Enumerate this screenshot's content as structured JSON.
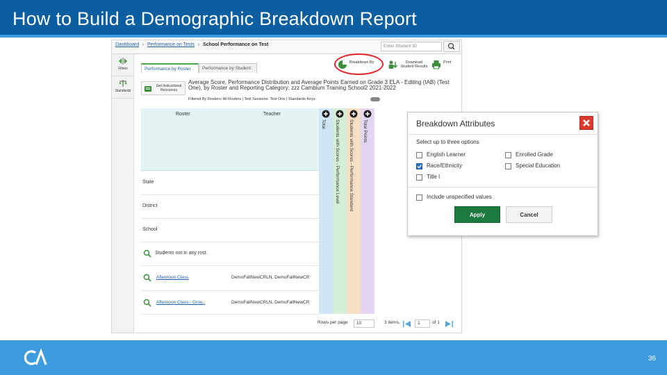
{
  "slide": {
    "title": "How to Build a Demographic Breakdown Report",
    "page_number": "36",
    "colors": {
      "title_bar": "#0b5fa0",
      "footer": "#3d9be0",
      "highlight": "#e0252a",
      "apply": "#1c7a3f"
    }
  },
  "app": {
    "breadcrumb": {
      "dashboard": "Dashboard",
      "performance": "Performance on Tests",
      "current": "School Performance on Test"
    },
    "search": {
      "placeholder": "Enter Student ID"
    },
    "sidebar": [
      {
        "label": "Filters",
        "icon": "filter-icon"
      },
      {
        "label": "Standards",
        "icon": "scale-icon"
      }
    ],
    "tabs": [
      "Performance by Roster",
      "Performance by Student"
    ],
    "toolbar": {
      "breakdown": "Breakdown By",
      "download": "Download Student Results",
      "print": "Print"
    },
    "generate_button": "Get Instructional Resources",
    "report_title": "Average Score, Performance Distribution and Average Points Earned on Grade 3 ELA - Editing (IAB) (Test One), by Roster and Reporting Category: zzz Cambium Training School2 2021-2022",
    "filters_text": "Filtered By Rosters: All Rosters | Test Sessions: Test One | Standards Keys",
    "table": {
      "headers": {
        "roster": "Roster",
        "teacher": "Teacher"
      },
      "rows": [
        {
          "roster": "State",
          "teacher": "",
          "type": "plain"
        },
        {
          "roster": "District",
          "teacher": "",
          "type": "plain"
        },
        {
          "roster": "School",
          "teacher": "",
          "type": "plain"
        },
        {
          "roster": "Students not in any rost.",
          "teacher": "",
          "type": "group"
        },
        {
          "roster": "Afternoon Class",
          "teacher": "DemoFallNewCRLN, DemoFallNewCR",
          "type": "link"
        },
        {
          "roster": "Afternoon Class - Grou..",
          "teacher": "DemoFallNewCRLN, DemoFallNewCR",
          "type": "link"
        }
      ],
      "vertical_columns": [
        {
          "label": "Total",
          "color": "#cfe6f8"
        },
        {
          "label": "Students with Scores - Performance Level",
          "color": "#d5efd6"
        },
        {
          "label": "Students with Scores - Performance Standard",
          "color": "#f7dfc6"
        },
        {
          "label": "Total Points",
          "color": "#e2d6f2"
        }
      ]
    },
    "pager": {
      "rows_label": "Rows per page",
      "rows_value": "10",
      "items_label": "3 items,",
      "page_value": "1",
      "of_label": "of 1"
    }
  },
  "modal": {
    "title": "Breakdown Attributes",
    "subtitle": "Select up to three options",
    "options_left": [
      {
        "label": "English Learner",
        "checked": false
      },
      {
        "label": "Race/Ethnicity",
        "checked": true
      },
      {
        "label": "Title I",
        "checked": false
      }
    ],
    "options_right": [
      {
        "label": "Enrolled Grade",
        "checked": false
      },
      {
        "label": "Special Education",
        "checked": false
      }
    ],
    "unspecified": {
      "label": "Include unspecified values",
      "checked": false
    },
    "apply": "Apply",
    "cancel": "Cancel"
  }
}
